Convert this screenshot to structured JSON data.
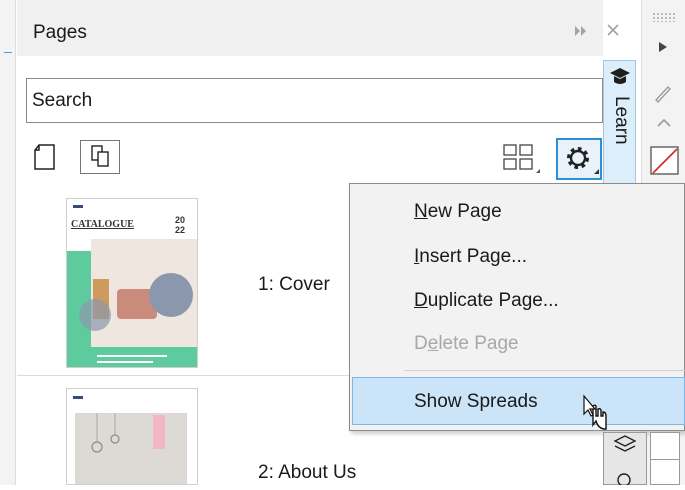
{
  "panel": {
    "title": "Pages",
    "search_placeholder": "Search",
    "learn_tab_label": "Learn"
  },
  "pages": [
    {
      "label": "1: Cover",
      "thumb_title": "CATALOGUE",
      "thumb_year_top": "20",
      "thumb_year_bottom": "22"
    },
    {
      "label": "2: About Us"
    }
  ],
  "context_menu": {
    "items": [
      {
        "pre": "",
        "u": "N",
        "post": "ew Page",
        "disabled": false
      },
      {
        "pre": "",
        "u": "I",
        "post": "nsert Page...",
        "disabled": false
      },
      {
        "pre": "",
        "u": "D",
        "post": "uplicate Page...",
        "disabled": false
      },
      {
        "pre": "D",
        "u": "e",
        "post": "lete Page",
        "disabled": true
      }
    ],
    "highlighted": "Show Spreads"
  },
  "icons": {
    "collapse": "double-chevron-right-icon",
    "close": "close-icon",
    "single_page": "single-page-icon",
    "facing_pages": "facing-pages-icon",
    "layout": "thumbnail-layout-icon",
    "settings": "gear-icon",
    "graduation": "graduation-cap-icon",
    "flyout": "flyout-arrow-icon",
    "pen": "pen-icon",
    "chevron_up": "chevron-up-icon",
    "no_color": "no-color-icon",
    "layers": "layers-icon",
    "cursor": "mouse-pointer-icon"
  },
  "colors": {
    "accent": "#2d8fd5",
    "menu_highlight": "#cce4f7",
    "thumb_green": "#5ecb9e",
    "no_color_red": "#e02020"
  }
}
